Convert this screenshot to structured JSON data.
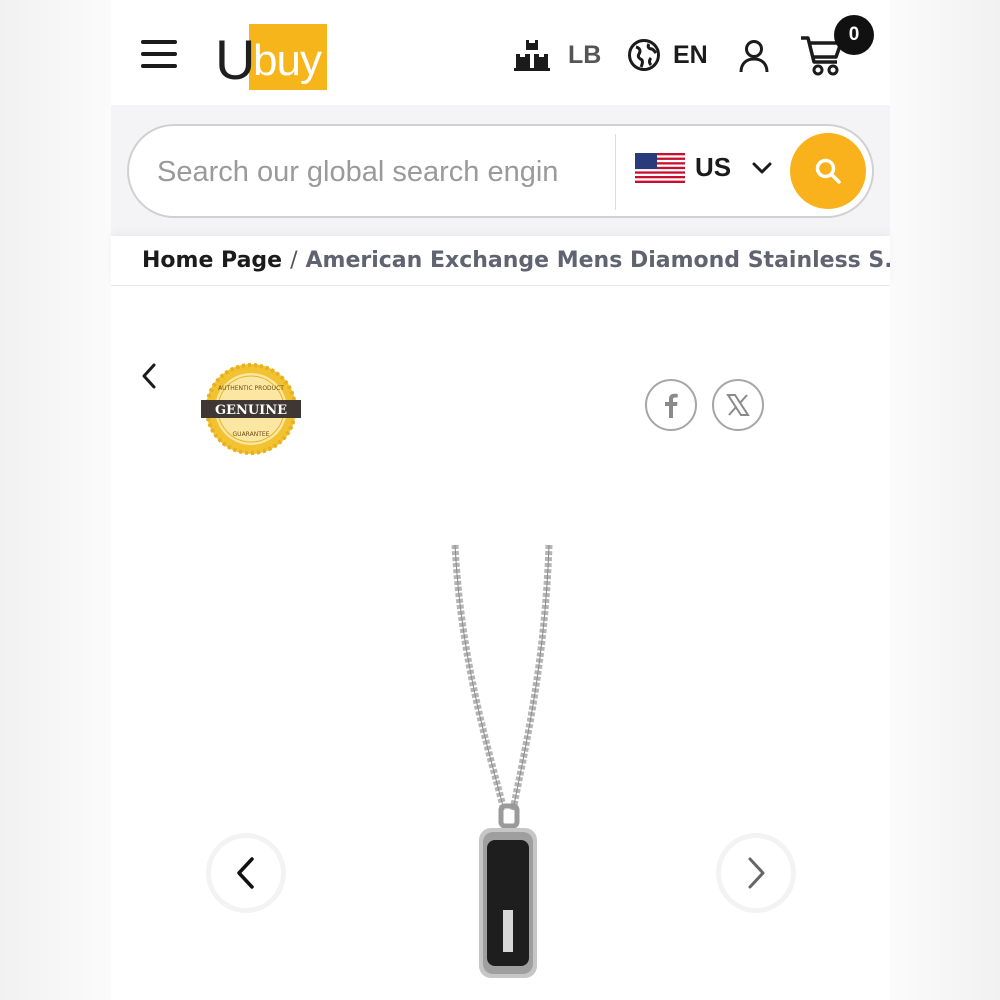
{
  "header": {
    "logo_u": "U",
    "logo_buy": "buy",
    "store_label": "LB",
    "language_label": "EN",
    "cart_count": "0"
  },
  "search": {
    "placeholder": "Search our global search engin",
    "country_label": "US"
  },
  "breadcrumb": {
    "home": "Home Page",
    "separator": "/",
    "current": "American Exchange Mens Diamond Stainless S..."
  },
  "product": {
    "badge_text": "GENUINE",
    "badge_top_text": "AUTHENTIC PRODUCT",
    "badge_bottom_text": "GUARANTEE"
  },
  "colors": {
    "brand_yellow": "#f7b51c",
    "dark": "#1b1b1b",
    "badge_gold": "#f2c230"
  },
  "icons": [
    "menu-icon",
    "store-icon",
    "globe-icon",
    "user-icon",
    "cart-icon",
    "us-flag-icon",
    "chevron-down-icon",
    "search-icon",
    "chevron-left-icon",
    "facebook-icon",
    "x-icon",
    "chevron-right-icon"
  ]
}
